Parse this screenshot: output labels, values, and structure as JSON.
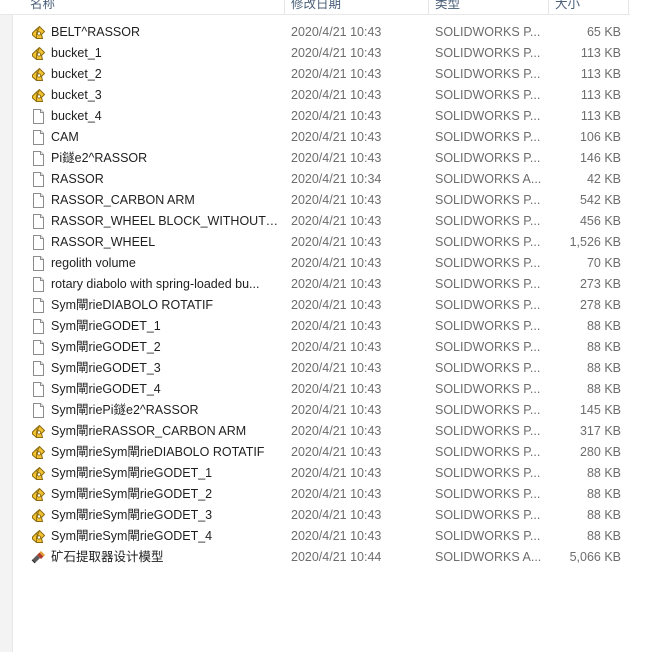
{
  "columns": {
    "name": "名称",
    "date": "修改日期",
    "type": "类型",
    "size": "大小"
  },
  "files": [
    {
      "name": "BELT^RASSOR",
      "date": "2020/4/21 10:43",
      "type": "SOLIDWORKS P...",
      "size": "65 KB",
      "icon": "solidworks-part-icon"
    },
    {
      "name": "bucket_1",
      "date": "2020/4/21 10:43",
      "type": "SOLIDWORKS P...",
      "size": "113 KB",
      "icon": "solidworks-part-icon"
    },
    {
      "name": "bucket_2",
      "date": "2020/4/21 10:43",
      "type": "SOLIDWORKS P...",
      "size": "113 KB",
      "icon": "solidworks-part-icon"
    },
    {
      "name": "bucket_3",
      "date": "2020/4/21 10:43",
      "type": "SOLIDWORKS P...",
      "size": "113 KB",
      "icon": "solidworks-part-icon"
    },
    {
      "name": "bucket_4",
      "date": "2020/4/21 10:43",
      "type": "SOLIDWORKS P...",
      "size": "113 KB",
      "icon": "file-icon"
    },
    {
      "name": "CAM",
      "date": "2020/4/21 10:43",
      "type": "SOLIDWORKS P...",
      "size": "106 KB",
      "icon": "file-icon"
    },
    {
      "name": "Pi鐩e2^RASSOR",
      "date": "2020/4/21 10:43",
      "type": "SOLIDWORKS P...",
      "size": "146 KB",
      "icon": "file-icon"
    },
    {
      "name": "RASSOR",
      "date": "2020/4/21 10:34",
      "type": "SOLIDWORKS A...",
      "size": "42 KB",
      "icon": "file-icon"
    },
    {
      "name": "RASSOR_CARBON ARM",
      "date": "2020/4/21 10:43",
      "type": "SOLIDWORKS P...",
      "size": "542 KB",
      "icon": "file-icon"
    },
    {
      "name": "RASSOR_WHEEL BLOCK_WITHOUT W...",
      "date": "2020/4/21 10:43",
      "type": "SOLIDWORKS P...",
      "size": "456 KB",
      "icon": "file-icon"
    },
    {
      "name": "RASSOR_WHEEL",
      "date": "2020/4/21 10:43",
      "type": "SOLIDWORKS P...",
      "size": "1,526 KB",
      "icon": "file-icon"
    },
    {
      "name": "regolith volume",
      "date": "2020/4/21 10:43",
      "type": "SOLIDWORKS P...",
      "size": "70 KB",
      "icon": "file-icon"
    },
    {
      "name": "rotary diabolo with spring-loaded bu...",
      "date": "2020/4/21 10:43",
      "type": "SOLIDWORKS P...",
      "size": "273 KB",
      "icon": "file-icon"
    },
    {
      "name": "Sym閘rieDIABOLO ROTATIF",
      "date": "2020/4/21 10:43",
      "type": "SOLIDWORKS P...",
      "size": "278 KB",
      "icon": "file-icon"
    },
    {
      "name": "Sym閘rieGODET_1",
      "date": "2020/4/21 10:43",
      "type": "SOLIDWORKS P...",
      "size": "88 KB",
      "icon": "file-icon"
    },
    {
      "name": "Sym閘rieGODET_2",
      "date": "2020/4/21 10:43",
      "type": "SOLIDWORKS P...",
      "size": "88 KB",
      "icon": "file-icon"
    },
    {
      "name": "Sym閘rieGODET_3",
      "date": "2020/4/21 10:43",
      "type": "SOLIDWORKS P...",
      "size": "88 KB",
      "icon": "file-icon"
    },
    {
      "name": "Sym閘rieGODET_4",
      "date": "2020/4/21 10:43",
      "type": "SOLIDWORKS P...",
      "size": "88 KB",
      "icon": "file-icon"
    },
    {
      "name": "Sym閘riePi鐩e2^RASSOR",
      "date": "2020/4/21 10:43",
      "type": "SOLIDWORKS P...",
      "size": "145 KB",
      "icon": "file-icon"
    },
    {
      "name": "Sym閘rieRASSOR_CARBON ARM",
      "date": "2020/4/21 10:43",
      "type": "SOLIDWORKS P...",
      "size": "317 KB",
      "icon": "solidworks-part-icon"
    },
    {
      "name": "Sym閘rieSym閘rieDIABOLO ROTATIF",
      "date": "2020/4/21 10:43",
      "type": "SOLIDWORKS P...",
      "size": "280 KB",
      "icon": "solidworks-part-icon"
    },
    {
      "name": "Sym閘rieSym閘rieGODET_1",
      "date": "2020/4/21 10:43",
      "type": "SOLIDWORKS P...",
      "size": "88 KB",
      "icon": "solidworks-part-icon"
    },
    {
      "name": "Sym閘rieSym閘rieGODET_2",
      "date": "2020/4/21 10:43",
      "type": "SOLIDWORKS P...",
      "size": "88 KB",
      "icon": "solidworks-part-icon"
    },
    {
      "name": "Sym閘rieSym閘rieGODET_3",
      "date": "2020/4/21 10:43",
      "type": "SOLIDWORKS P...",
      "size": "88 KB",
      "icon": "solidworks-part-icon"
    },
    {
      "name": "Sym閘rieSym閘rieGODET_4",
      "date": "2020/4/21 10:43",
      "type": "SOLIDWORKS P...",
      "size": "88 KB",
      "icon": "solidworks-part-icon"
    },
    {
      "name": "矿石提取器设计模型",
      "date": "2020/4/21 10:44",
      "type": "SOLIDWORKS A...",
      "size": "5,066 KB",
      "icon": "solidworks-assembly-icon"
    }
  ],
  "colors": {
    "header_text": "#4c607a",
    "secondary_text": "#6d6d6d",
    "part_icon_fill": "#f2c230",
    "part_icon_stroke": "#8a6a12"
  }
}
